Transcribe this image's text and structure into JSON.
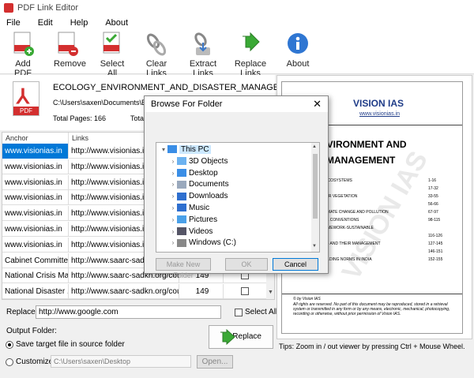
{
  "app": {
    "title": "PDF Link Editor"
  },
  "menu": {
    "file": "File",
    "edit": "Edit",
    "help": "Help",
    "about": "About"
  },
  "toolbar": {
    "add_pdf": "Add PDF",
    "remove": "Remove",
    "select_all": "Select All",
    "clear_links": "Clear Links",
    "extract_links": "Extract Links",
    "replace_links": "Replace Links",
    "about": "About"
  },
  "file": {
    "icon_label": "PDF",
    "name": "ECOLOGY_ENVIRONMENT_AND_DISASTER_MANAGEMENT.pdf",
    "path": "C:\\Users\\saxen\\Documents\\ECOL",
    "total_pages": "Total Pages: 166",
    "total_links": "Total"
  },
  "table": {
    "headers": {
      "anchor": "Anchor",
      "links": "Links"
    },
    "rows": [
      {
        "anchor": "www.visionias.in",
        "link": "http://www.visionias.in/",
        "page": "",
        "selected": true
      },
      {
        "anchor": "www.visionias.in",
        "link": "http://www.visionias.in/",
        "page": ""
      },
      {
        "anchor": "www.visionias.in",
        "link": "http://www.visionias.in/",
        "page": ""
      },
      {
        "anchor": "www.visionias.in",
        "link": "http://www.visionias.in/",
        "page": ""
      },
      {
        "anchor": "www.visionias.in",
        "link": "http://www.visionias.in/",
        "page": ""
      },
      {
        "anchor": "www.visionias.in",
        "link": "http://www.visionias.in/",
        "page": ""
      },
      {
        "anchor": "www.visionias.in",
        "link": "http://www.visionias.in/",
        "page": ""
      },
      {
        "anchor": "Cabinet Committe...",
        "link": "http://www.saarc-sadkn.org/",
        "page": ""
      },
      {
        "anchor": "National Crisis Ma...",
        "link": "http://www.saarc-sadkn.org/cou...",
        "page": "149"
      },
      {
        "anchor": "National Disaster ...",
        "link": "http://www.saarc-sadkn.org/cou...",
        "page": "149"
      }
    ]
  },
  "replace": {
    "label": "Replace:",
    "value": "http://www.google.com",
    "select_all": "Select All"
  },
  "output": {
    "label": "Output Folder:",
    "option_source": "Save target file in source folder",
    "option_custom": "Customize:",
    "custom_path": "C:\\Users\\saxen\\Desktop",
    "open_button": "Open...",
    "replace_button": "Replace"
  },
  "dialog": {
    "title": "Browse For Folder",
    "close": "✕",
    "tree": [
      {
        "label": "This PC",
        "level": 0,
        "chevron": "▾",
        "icon": "pc-icon",
        "selected": true
      },
      {
        "label": "3D Objects",
        "level": 1,
        "chevron": "›",
        "icon": "folder-3d-icon"
      },
      {
        "label": "Desktop",
        "level": 1,
        "chevron": "›",
        "icon": "desktop-icon"
      },
      {
        "label": "Documents",
        "level": 1,
        "chevron": "›",
        "icon": "documents-icon"
      },
      {
        "label": "Downloads",
        "level": 1,
        "chevron": "›",
        "icon": "downloads-icon"
      },
      {
        "label": "Music",
        "level": 1,
        "chevron": "›",
        "icon": "music-icon"
      },
      {
        "label": "Pictures",
        "level": 1,
        "chevron": "›",
        "icon": "pictures-icon"
      },
      {
        "label": "Videos",
        "level": 1,
        "chevron": "›",
        "icon": "videos-icon"
      },
      {
        "label": "Windows (C:)",
        "level": 1,
        "chevron": "›",
        "icon": "drive-icon"
      }
    ],
    "make_new_folder": "Make New Folder",
    "ok": "OK",
    "cancel": "Cancel"
  },
  "preview": {
    "brand": "VISION IAS",
    "brand_url": "www.visionias.in",
    "heading_line1": "OGY, ENVIRONMENT AND",
    "heading_line2": "ASTER MANAGEMENT",
    "watermark": "VISION IAS",
    "toc": [
      {
        "text": "AND WORKING OF ECOSYSTEMS",
        "pages": "1-16"
      },
      {
        "text": "Y",
        "pages": "17-32"
      },
      {
        "text": "MUNITIES AND MAJOR VEGETATION",
        "pages": "33-55"
      },
      {
        "text": "",
        "pages": "56-66"
      },
      {
        "text": "ENTAL CHANGE: CLIMATE CHANGE AND POLLUTION",
        "pages": "67-97"
      },
      {
        "text": "AND INTERNATIONAL CONVENTIONS",
        "pages": "98-115"
      },
      {
        "text": "DEVELOPMENT FRAMEWORK-SUSTAINABLE",
        "pages": ""
      },
      {
        "text": "NT GOALS",
        "pages": "116-126"
      },
      {
        "text": "AZARDS, DISASTERS AND THEIR MANAGEMENT",
        "pages": "127-145"
      },
      {
        "text": "",
        "pages": "146-151"
      },
      {
        "text": "HABITAT GREEN BUILDING NORMS IN INDIA",
        "pages": "152-155"
      }
    ],
    "copyright": "© by Vision IAS",
    "rights": "All rights are reserved. No part of this document may be reproduced, stored in a retrieval system or transmitted in any form or by any means, electronic, mechanical, photocopying, recording or otherwise, without prior permission of Vision IAS."
  },
  "status": {
    "tips": "Tips: Zoom in / out viewer by pressing Ctrl + Mouse Wheel."
  },
  "colors": {
    "accent": "#0078d7",
    "pdf_red": "#d32f2f",
    "brand_blue": "#1f3c88",
    "arrow_green": "#3aa935"
  }
}
